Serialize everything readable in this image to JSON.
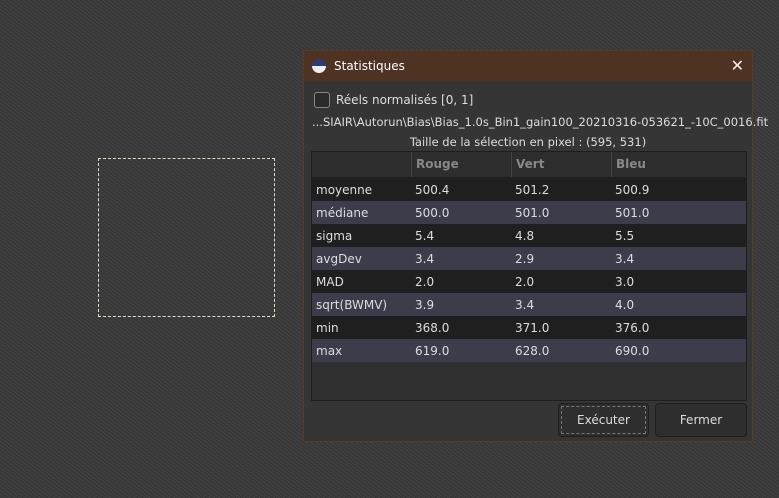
{
  "dialog": {
    "title": "Statistiques",
    "checkbox_label": "Réels normalisés [0, 1]",
    "checkbox_checked": false,
    "path": "...SIAIR\\Autorun\\Bias\\Bias_1.0s_Bin1_gain100_20210316-053621_-10C_0016.fit",
    "selection_size": "Taille de la sélection en pixel : (595, 531)",
    "table": {
      "headers": [
        "",
        "Rouge",
        "Vert",
        "Bleu"
      ],
      "rows": [
        [
          "moyenne",
          "500.4",
          "501.2",
          "500.9"
        ],
        [
          "médiane",
          "500.0",
          "501.0",
          "501.0"
        ],
        [
          "sigma",
          "5.4",
          "4.8",
          "5.5"
        ],
        [
          "avgDev",
          "3.4",
          "2.9",
          "3.4"
        ],
        [
          "MAD",
          "2.0",
          "2.0",
          "3.0"
        ],
        [
          "sqrt(BWMV)",
          "3.9",
          "3.4",
          "4.0"
        ],
        [
          "min",
          "368.0",
          "371.0",
          "376.0"
        ],
        [
          "max",
          "619.0",
          "628.0",
          "690.0"
        ]
      ]
    },
    "buttons": {
      "run": "Exécuter",
      "close": "Fermer"
    }
  }
}
